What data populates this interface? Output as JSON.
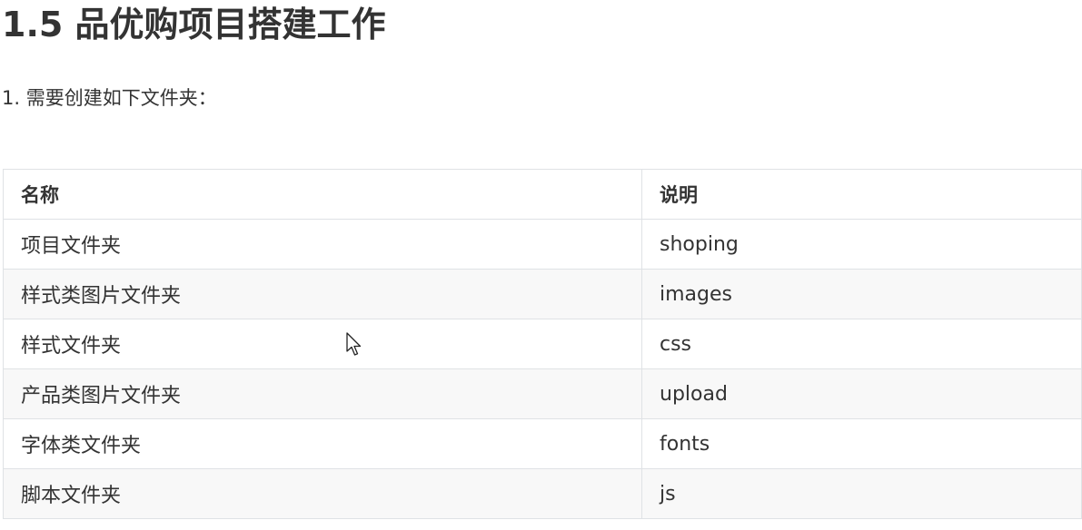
{
  "heading": "1.5 品优购项目搭建工作",
  "intro": "1. 需要创建如下文件夹：",
  "table": {
    "headers": [
      "名称",
      "说明"
    ],
    "rows": [
      [
        "项目文件夹",
        "shoping"
      ],
      [
        "样式类图片文件夹",
        "images"
      ],
      [
        "样式文件夹",
        "css"
      ],
      [
        "产品类图片文件夹",
        "upload"
      ],
      [
        "字体类文件夹",
        "fonts"
      ],
      [
        "脚本文件夹",
        "js"
      ]
    ]
  },
  "colors": {
    "text": "#333333",
    "border": "#dfe2e5",
    "stripe": "#f8f8f8"
  },
  "icons": {
    "cursor": "mouse-pointer-icon"
  }
}
